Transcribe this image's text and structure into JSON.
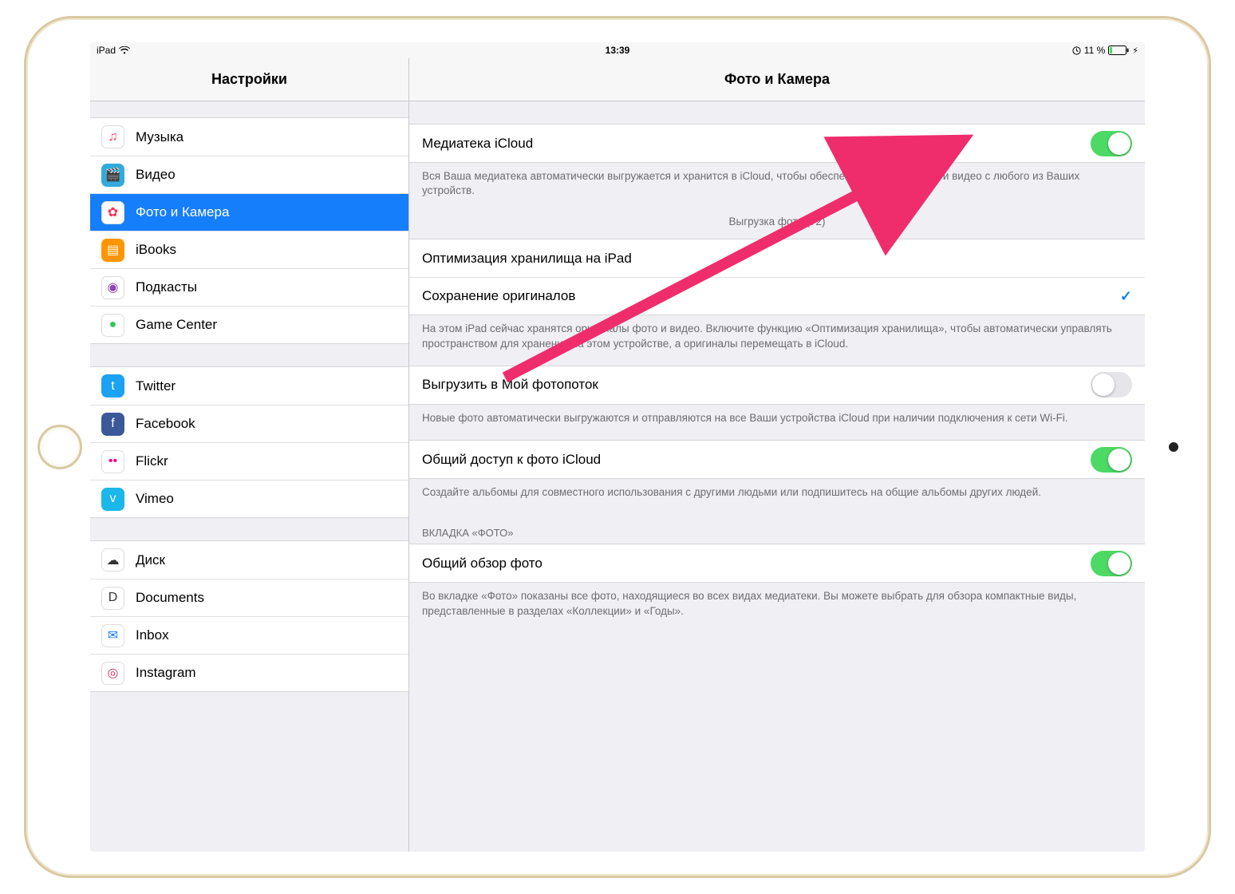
{
  "status": {
    "device": "iPad",
    "time": "13:39",
    "battery": "11 %"
  },
  "sidebar": {
    "title": "Настройки",
    "groups": [
      {
        "items": [
          {
            "label": "Музыка",
            "icon_bg": "#ffffff",
            "icon_color": "#fc3d5b",
            "glyph": "♫",
            "selected": false
          },
          {
            "label": "Видео",
            "icon_bg": "#32aadc",
            "icon_color": "#fff",
            "glyph": "🎬",
            "selected": false
          },
          {
            "label": "Фото и Камера",
            "icon_bg": "#ffffff",
            "icon_color": "#ff2d55",
            "glyph": "✿",
            "selected": true
          },
          {
            "label": "iBooks",
            "icon_bg": "#ff9500",
            "icon_color": "#fff",
            "glyph": "▤",
            "selected": false
          },
          {
            "label": "Подкасты",
            "icon_bg": "#ffffff",
            "icon_color": "#8e44ad",
            "glyph": "◉",
            "selected": false
          },
          {
            "label": "Game Center",
            "icon_bg": "#ffffff",
            "icon_color": "#34c759",
            "glyph": "●",
            "selected": false
          }
        ]
      },
      {
        "items": [
          {
            "label": "Twitter",
            "icon_bg": "#1da1f2",
            "icon_color": "#fff",
            "glyph": "t",
            "selected": false
          },
          {
            "label": "Facebook",
            "icon_bg": "#3b5998",
            "icon_color": "#fff",
            "glyph": "f",
            "selected": false
          },
          {
            "label": "Flickr",
            "icon_bg": "#ffffff",
            "icon_color": "#ff0084",
            "glyph": "••",
            "selected": false
          },
          {
            "label": "Vimeo",
            "icon_bg": "#1ab7ea",
            "icon_color": "#fff",
            "glyph": "v",
            "selected": false
          }
        ]
      },
      {
        "items": [
          {
            "label": "Диск",
            "icon_bg": "#ffffff",
            "icon_color": "#333",
            "glyph": "☁",
            "selected": false
          },
          {
            "label": "Documents",
            "icon_bg": "#ffffff",
            "icon_color": "#333",
            "glyph": "D",
            "selected": false
          },
          {
            "label": "Inbox",
            "icon_bg": "#ffffff",
            "icon_color": "#157efb",
            "glyph": "✉",
            "selected": false
          },
          {
            "label": "Instagram",
            "icon_bg": "#ffffff",
            "icon_color": "#e1306c",
            "glyph": "◎",
            "selected": false
          }
        ]
      }
    ]
  },
  "detail": {
    "title": "Фото и Камера",
    "sections": [
      {
        "cells": [
          {
            "label": "Медиатека iCloud",
            "type": "toggle",
            "on": true
          }
        ],
        "footer": "Вся Ваша медиатека автоматически выгружается и хранится в iCloud, чтобы обеспечить доступ к фото и видео с любого из Ваших устройств.",
        "center_note": "Выгрузка фото (72)"
      },
      {
        "cells": [
          {
            "label": "Оптимизация хранилища на iPad",
            "type": "option",
            "checked": false
          },
          {
            "label": "Сохранение оригиналов",
            "type": "option",
            "checked": true
          }
        ],
        "footer": "На этом iPad сейчас хранятся оригиналы фото и видео. Включите функцию «Оптимизация хранилища», чтобы автоматически управлять пространством для хранения на этом устройстве, а оригиналы перемещать в iCloud."
      },
      {
        "cells": [
          {
            "label": "Выгрузить в Мой фотопоток",
            "type": "toggle",
            "on": false
          }
        ],
        "footer": "Новые фото автоматически выгружаются и отправляются на все Ваши устройства iCloud при наличии подключения к сети Wi-Fi."
      },
      {
        "cells": [
          {
            "label": "Общий доступ к фото iCloud",
            "type": "toggle",
            "on": true
          }
        ],
        "footer": "Создайте альбомы для совместного использования с другими людьми или подпишитесь на общие альбомы других людей."
      },
      {
        "header": "ВКЛАДКА «ФОТО»",
        "cells": [
          {
            "label": "Общий обзор фото",
            "type": "toggle",
            "on": true
          }
        ],
        "footer": "Во вкладке «Фото» показаны все фото, находящиеся во всех видах медиатеки. Вы можете выбрать для обзора компактные виды, представленные в разделах «Коллекции» и «Годы»."
      }
    ]
  }
}
